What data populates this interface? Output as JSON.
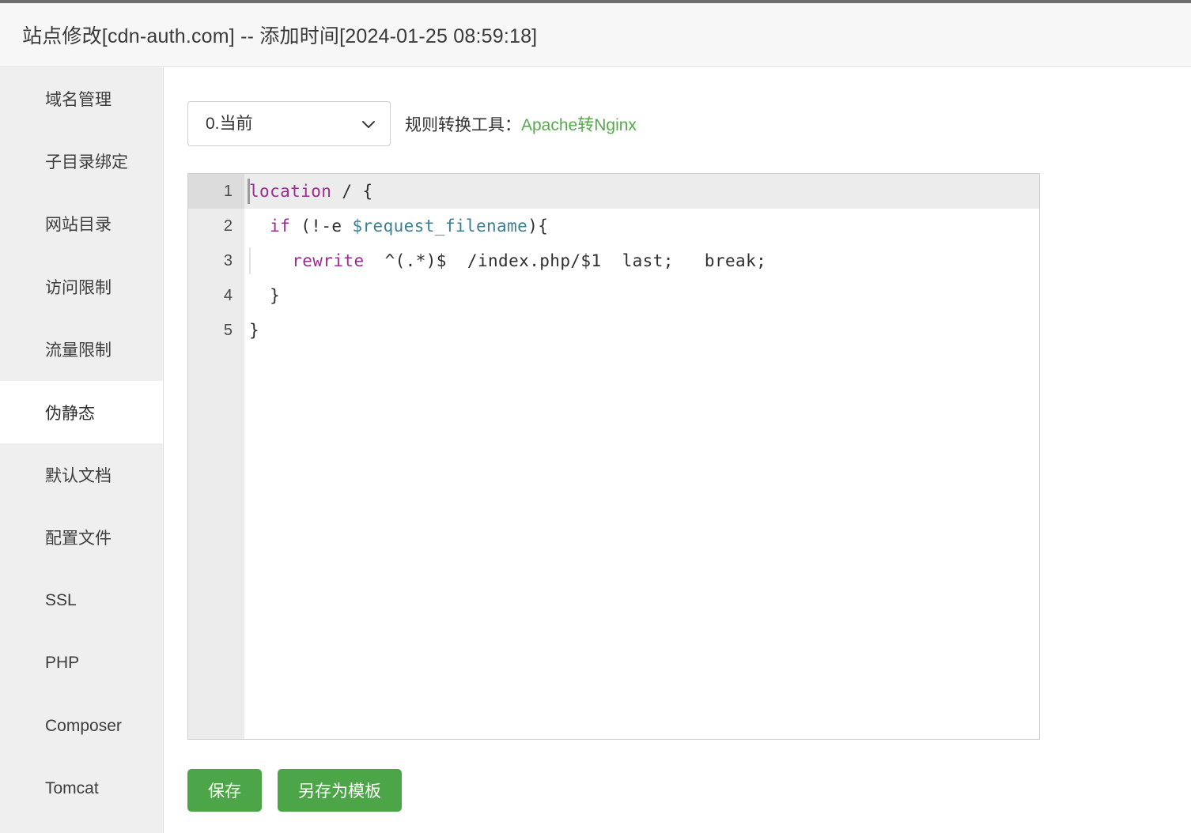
{
  "header": {
    "title": "站点修改[cdn-auth.com] -- 添加时间[2024-01-25 08:59:18]"
  },
  "sidebar": {
    "items": [
      {
        "label": "域名管理",
        "active": false
      },
      {
        "label": "子目录绑定",
        "active": false
      },
      {
        "label": "网站目录",
        "active": false
      },
      {
        "label": "访问限制",
        "active": false
      },
      {
        "label": "流量限制",
        "active": false
      },
      {
        "label": "伪静态",
        "active": true
      },
      {
        "label": "默认文档",
        "active": false
      },
      {
        "label": "配置文件",
        "active": false
      },
      {
        "label": "SSL",
        "active": false
      },
      {
        "label": "PHP",
        "active": false
      },
      {
        "label": "Composer",
        "active": false
      },
      {
        "label": "Tomcat",
        "active": false
      }
    ]
  },
  "toolbar": {
    "select": {
      "value": "0.当前",
      "icon": "chevron-down-icon",
      "options": [
        "0.当前"
      ]
    },
    "converter_label": "规则转换工具：",
    "converter_link": "Apache转Nginx"
  },
  "editor": {
    "line_numbers": [
      "1",
      "2",
      "3",
      "4",
      "5"
    ],
    "lines": [
      {
        "number": "1",
        "active": true,
        "tokens": [
          {
            "text": "location",
            "type": "keyword"
          },
          {
            "text": " / {",
            "type": "plain"
          }
        ]
      },
      {
        "number": "2",
        "active": false,
        "tokens": [
          {
            "text": "  ",
            "type": "plain"
          },
          {
            "text": "if",
            "type": "keyword"
          },
          {
            "text": " (!-e ",
            "type": "plain"
          },
          {
            "text": "$request_filename",
            "type": "variable"
          },
          {
            "text": "){",
            "type": "plain"
          }
        ]
      },
      {
        "number": "3",
        "active": false,
        "tokens": [
          {
            "text": "    ",
            "type": "plain"
          },
          {
            "text": "rewrite",
            "type": "keyword"
          },
          {
            "text": "  ^(.*)$  /index.php/$1  last;   break;",
            "type": "plain"
          }
        ]
      },
      {
        "number": "4",
        "active": false,
        "tokens": [
          {
            "text": "  }",
            "type": "plain"
          }
        ]
      },
      {
        "number": "5",
        "active": false,
        "tokens": [
          {
            "text": "}",
            "type": "plain"
          }
        ]
      }
    ],
    "plain_text": "location / {\n  if (!-e $request_filename){\n    rewrite  ^(.*)$  /index.php/$1  last;   break;\n  }\n}"
  },
  "buttons": {
    "save": "保存",
    "save_as_template": "另存为模板"
  },
  "colors": {
    "accent_green": "#4ca546",
    "link_green": "#56a94c",
    "header_bg": "#f7f7f7",
    "sidebar_bg": "#efefef",
    "gutter_bg": "#ececec",
    "active_line_bg": "#ececec",
    "keyword": "#9b2d8f",
    "variable": "#3d7f92"
  }
}
